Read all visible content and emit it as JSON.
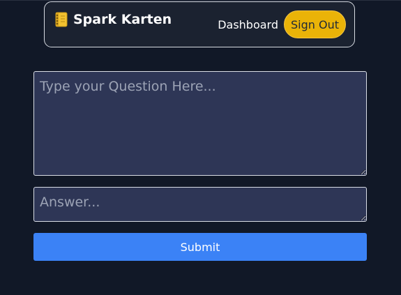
{
  "navbar": {
    "icon": "notebook-icon",
    "title": "Spark Karten",
    "dashboard_label": "Dashboard",
    "signout_label": "Sign Out"
  },
  "form": {
    "question_placeholder": "Type your Question Here...",
    "question_value": "",
    "answer_placeholder": "Answer...",
    "answer_value": "",
    "submit_label": "Submit"
  },
  "colors": {
    "background": "#111827",
    "accent": "#3b82f6",
    "signout": "#eab308",
    "field": "#2e3656"
  }
}
